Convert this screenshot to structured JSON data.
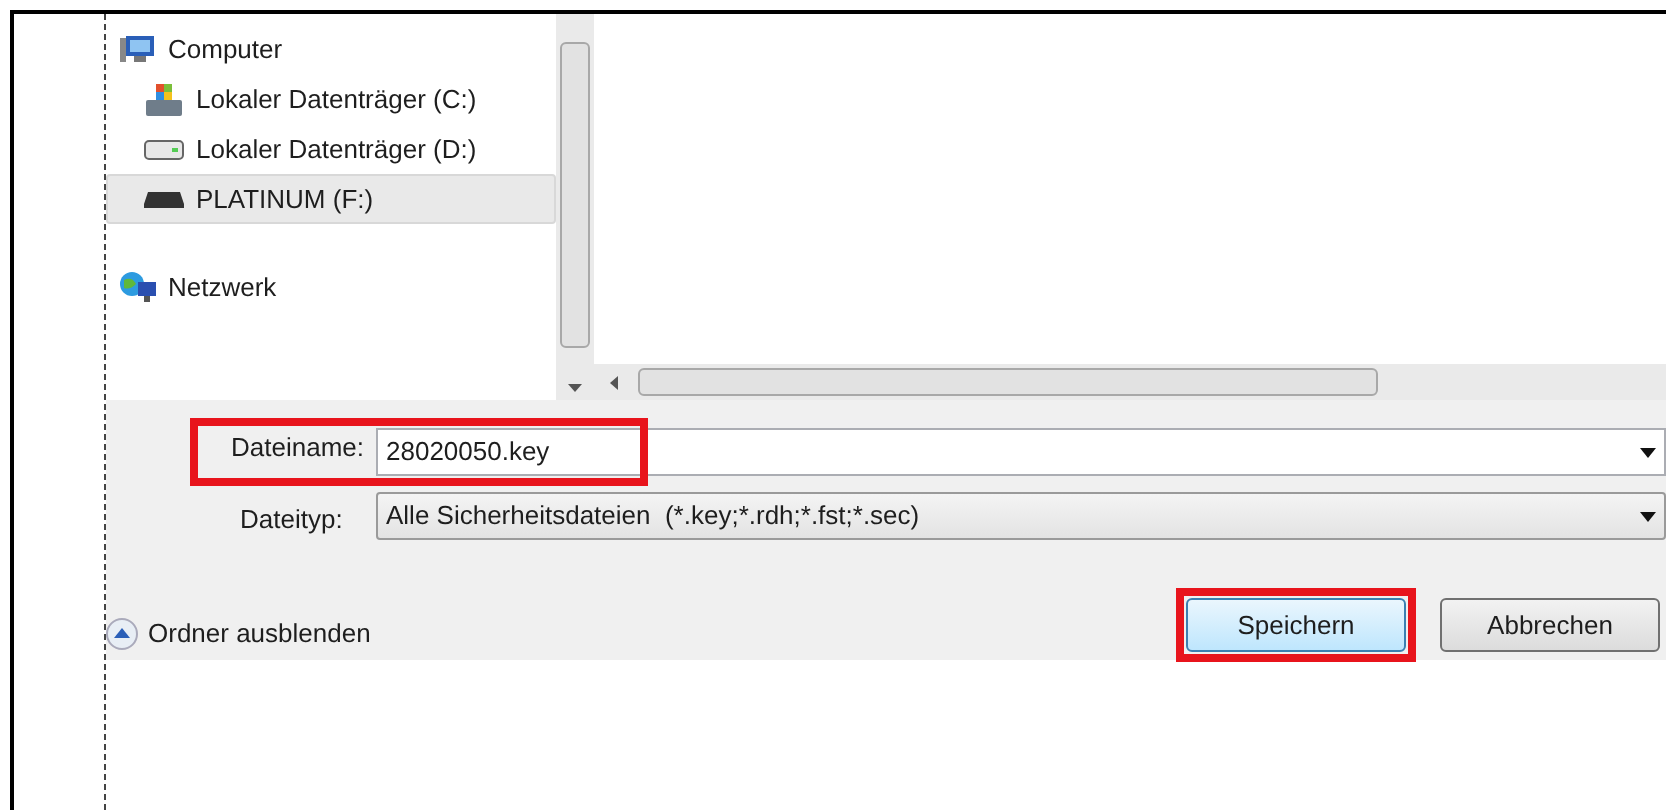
{
  "navigation": {
    "items": [
      {
        "label": "Computer",
        "kind": "computer",
        "selected": false,
        "children": [
          {
            "label": "Lokaler Datenträger (C:)",
            "kind": "system-drive",
            "selected": false
          },
          {
            "label": "Lokaler Datenträger (D:)",
            "kind": "drive",
            "selected": false
          },
          {
            "label": "PLATINUM (F:)",
            "kind": "usb-drive",
            "selected": true
          }
        ]
      },
      {
        "label": "Netzwerk",
        "kind": "network",
        "selected": false
      }
    ]
  },
  "filename": {
    "label": "Dateiname:",
    "value": "28020050.key",
    "highlighted": true
  },
  "filetype": {
    "label": "Dateityp:",
    "value": "Alle Sicherheitsdateien  (*.key;*.rdh;*.fst;*.sec)"
  },
  "hide_folders": {
    "label": "Ordner ausblenden"
  },
  "buttons": [
    {
      "label": "Speichern",
      "highlighted": true,
      "kind": "default"
    },
    {
      "label": "Abbrechen",
      "highlighted": false,
      "kind": "normal"
    }
  ]
}
